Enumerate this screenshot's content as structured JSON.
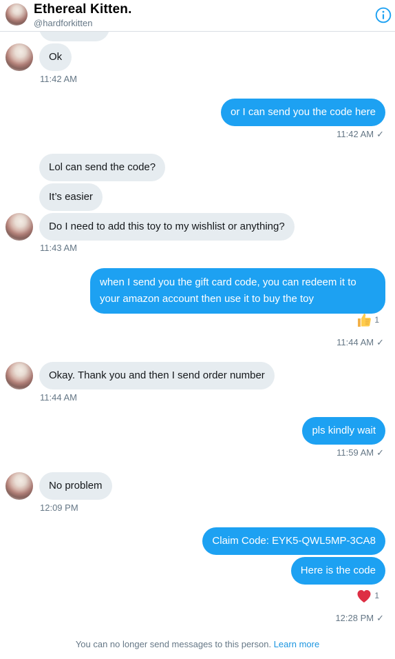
{
  "header": {
    "title": "Ethereal Kitten.",
    "handle": "@hardforkitten",
    "info_icon": "info-circle-icon",
    "accent": "#1da1f2"
  },
  "messages": [
    {
      "id": "m0",
      "side": "in",
      "text": "",
      "partial": true
    },
    {
      "id": "m1",
      "side": "in",
      "text": "Ok",
      "time": "11:42 AM"
    },
    {
      "id": "m2",
      "side": "out",
      "text": "or I can send you the code here",
      "time": "11:42 AM"
    },
    {
      "id": "m3",
      "side": "in",
      "text": "Lol can send the code?"
    },
    {
      "id": "m4",
      "side": "in",
      "text": "It’s easier"
    },
    {
      "id": "m5",
      "side": "in",
      "text": "Do I need to add this toy to my wishlist or anything?",
      "time": "11:43 AM"
    },
    {
      "id": "m6",
      "side": "out",
      "text": "when I send you the gift card code, you can redeem it to your  amazon account then use it to buy the toy",
      "reaction": {
        "icon": "thumbs-up-icon",
        "count": "1"
      },
      "time": "11:44 AM"
    },
    {
      "id": "m7",
      "side": "in",
      "text": "Okay. Thank you and then I send order number",
      "time": "11:44 AM"
    },
    {
      "id": "m8",
      "side": "out",
      "text": "pls kindly wait",
      "time": "11:59 AM"
    },
    {
      "id": "m9",
      "side": "in",
      "text": "No problem",
      "time": "12:09 PM"
    },
    {
      "id": "m10",
      "side": "out",
      "text": "Claim Code: EYK5-QWL5MP-3CA8"
    },
    {
      "id": "m11",
      "side": "out",
      "text": "Here is the code",
      "reaction": {
        "icon": "heart-icon",
        "count": "1"
      },
      "time": "12:28 PM"
    }
  ],
  "read_check": "✓",
  "footer": {
    "notice": "You can no longer send messages to this person.",
    "link": "Learn more"
  }
}
